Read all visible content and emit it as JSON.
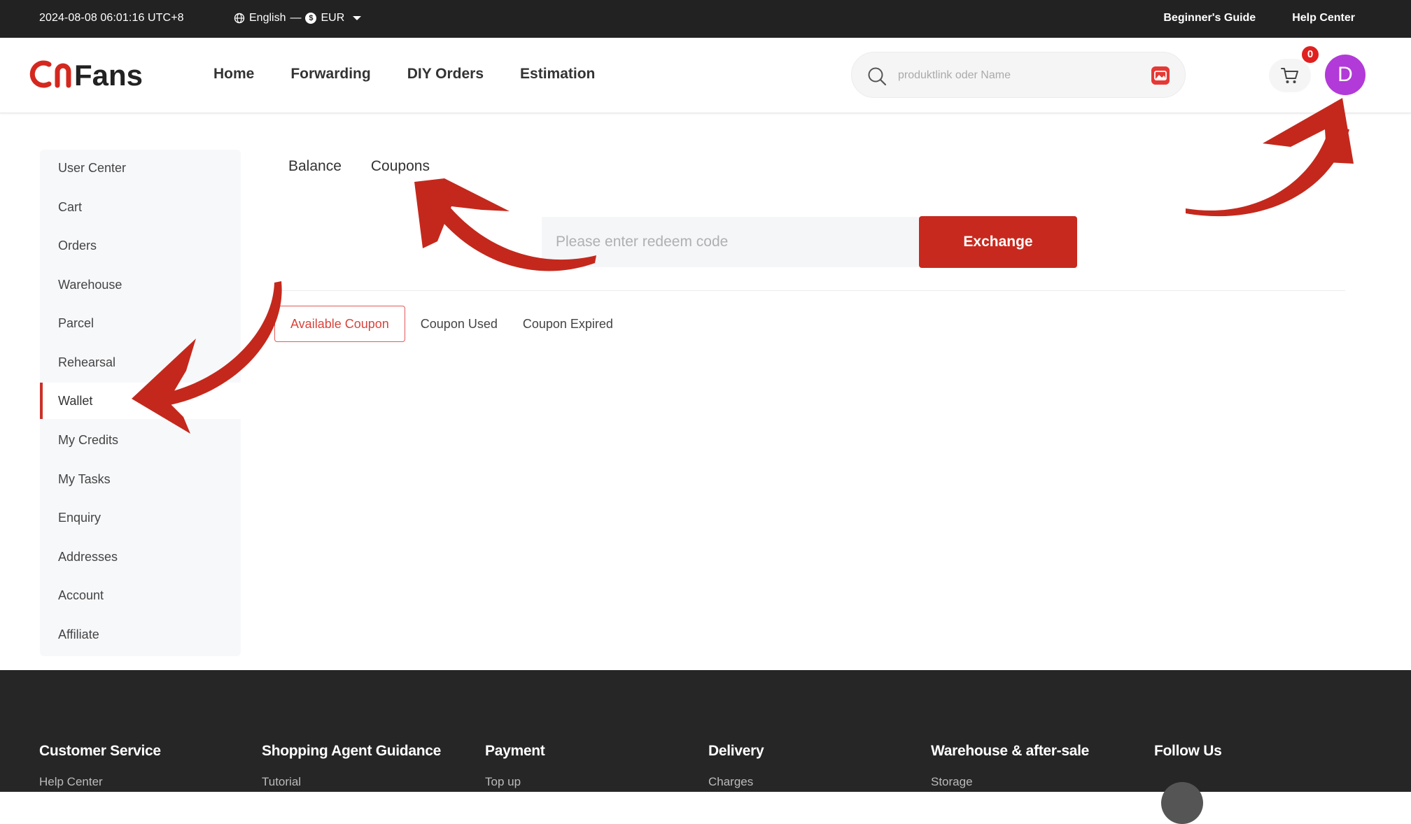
{
  "topbar": {
    "datetime": "2024-08-08 06:01:16 UTC+8",
    "language": "English",
    "currency": "EUR",
    "links": [
      "Beginner's Guide",
      "Help Center"
    ]
  },
  "header": {
    "logo_text": "CNFANS",
    "nav": [
      "Home",
      "Forwarding",
      "DIY Orders",
      "Estimation"
    ],
    "search_placeholder": "produktlink oder Name",
    "cart_count": "0",
    "avatar_letter": "D"
  },
  "sidebar": {
    "items": [
      "User Center",
      "Cart",
      "Orders",
      "Warehouse",
      "Parcel",
      "Rehearsal",
      "Wallet",
      "My Credits",
      "My Tasks",
      "Enquiry",
      "Addresses",
      "Account",
      "Affiliate"
    ],
    "active": "Wallet"
  },
  "wallet": {
    "tabs": [
      "Balance",
      "Coupons"
    ],
    "redeem_placeholder": "Please enter redeem code",
    "exchange_label": "Exchange",
    "coupon_tabs": [
      "Available Coupon",
      "Coupon Used",
      "Coupon Expired"
    ]
  },
  "footer": {
    "columns": [
      {
        "title": "Customer Service",
        "link": "Help Center"
      },
      {
        "title": "Shopping Agent Guidance",
        "link": "Tutorial"
      },
      {
        "title": "Payment",
        "link": "Top up"
      },
      {
        "title": "Delivery",
        "link": "Charges"
      },
      {
        "title": "Warehouse & after-sale",
        "link": "Storage"
      },
      {
        "title": "Follow Us",
        "link": ""
      }
    ]
  },
  "colors": {
    "accent": "#c7291e",
    "topbar": "#222222",
    "footer": "#262626",
    "avatar": "#b23ad8",
    "arrow": "#c4281c"
  }
}
